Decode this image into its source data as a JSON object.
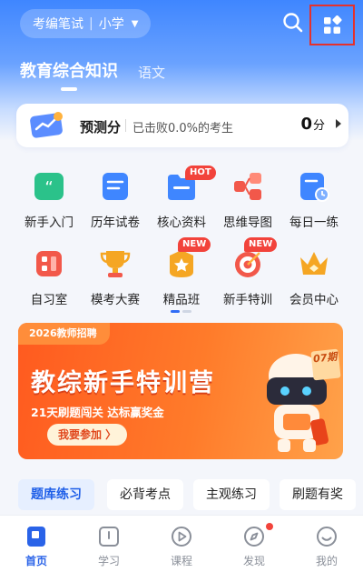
{
  "header": {
    "exam_select_label": "考编笔试",
    "level_label": "小学",
    "search_icon": "search-icon",
    "apps_icon": "apps-grid-icon"
  },
  "subject_tabs": [
    {
      "label": "教育综合知识",
      "active": true
    },
    {
      "label": "语文",
      "active": false
    }
  ],
  "score_card": {
    "title": "预测分",
    "description": "已击败0.0%的考生",
    "value": "0",
    "unit": "分"
  },
  "features": [
    {
      "label": "新手入门",
      "icon": "quote-book-icon",
      "color": "#2bc28a"
    },
    {
      "label": "历年试卷",
      "icon": "paper-icon",
      "color": "#3f86ff"
    },
    {
      "label": "核心资料",
      "icon": "folder-icon",
      "color": "#3f86ff",
      "badge": "HOT"
    },
    {
      "label": "思维导图",
      "icon": "mindmap-icon",
      "color": "#f2584a"
    },
    {
      "label": "每日一练",
      "icon": "daily-practice-icon",
      "color": "#3f86ff"
    },
    {
      "label": "自习室",
      "icon": "study-room-icon",
      "color": "#f2584a"
    },
    {
      "label": "模考大赛",
      "icon": "trophy-icon",
      "color": "#f5a623"
    },
    {
      "label": "精品班",
      "icon": "premium-class-icon",
      "color": "#f5a623",
      "badge": "NEW"
    },
    {
      "label": "新手特训",
      "icon": "target-icon",
      "color": "#f2584a",
      "badge": "NEW"
    },
    {
      "label": "会员中心",
      "icon": "crown-icon",
      "color": "#f5a623"
    }
  ],
  "banner": {
    "tag": "2026教师招聘",
    "title": "教综新手特训营",
    "subtitle": "21天刷题闯关 达标赢奖金",
    "button": "我要参加 〉",
    "issue": "07期"
  },
  "chips": [
    {
      "label": "题库练习",
      "active": true
    },
    {
      "label": "必背考点",
      "active": false
    },
    {
      "label": "主观练习",
      "active": false
    },
    {
      "label": "刷题有奖",
      "active": false
    }
  ],
  "bottom_nav": [
    {
      "label": "首页",
      "icon": "home-icon",
      "active": true
    },
    {
      "label": "学习",
      "icon": "study-icon",
      "active": false
    },
    {
      "label": "课程",
      "icon": "course-play-icon",
      "active": false
    },
    {
      "label": "发现",
      "icon": "discover-compass-icon",
      "active": false,
      "dot": true
    },
    {
      "label": "我的",
      "icon": "profile-icon",
      "active": false
    }
  ],
  "colors": {
    "primary": "#2a63e8",
    "accent_red": "#f2433b",
    "banner_orange": "#ff5a1f",
    "highlight_box": "#e5312c"
  }
}
